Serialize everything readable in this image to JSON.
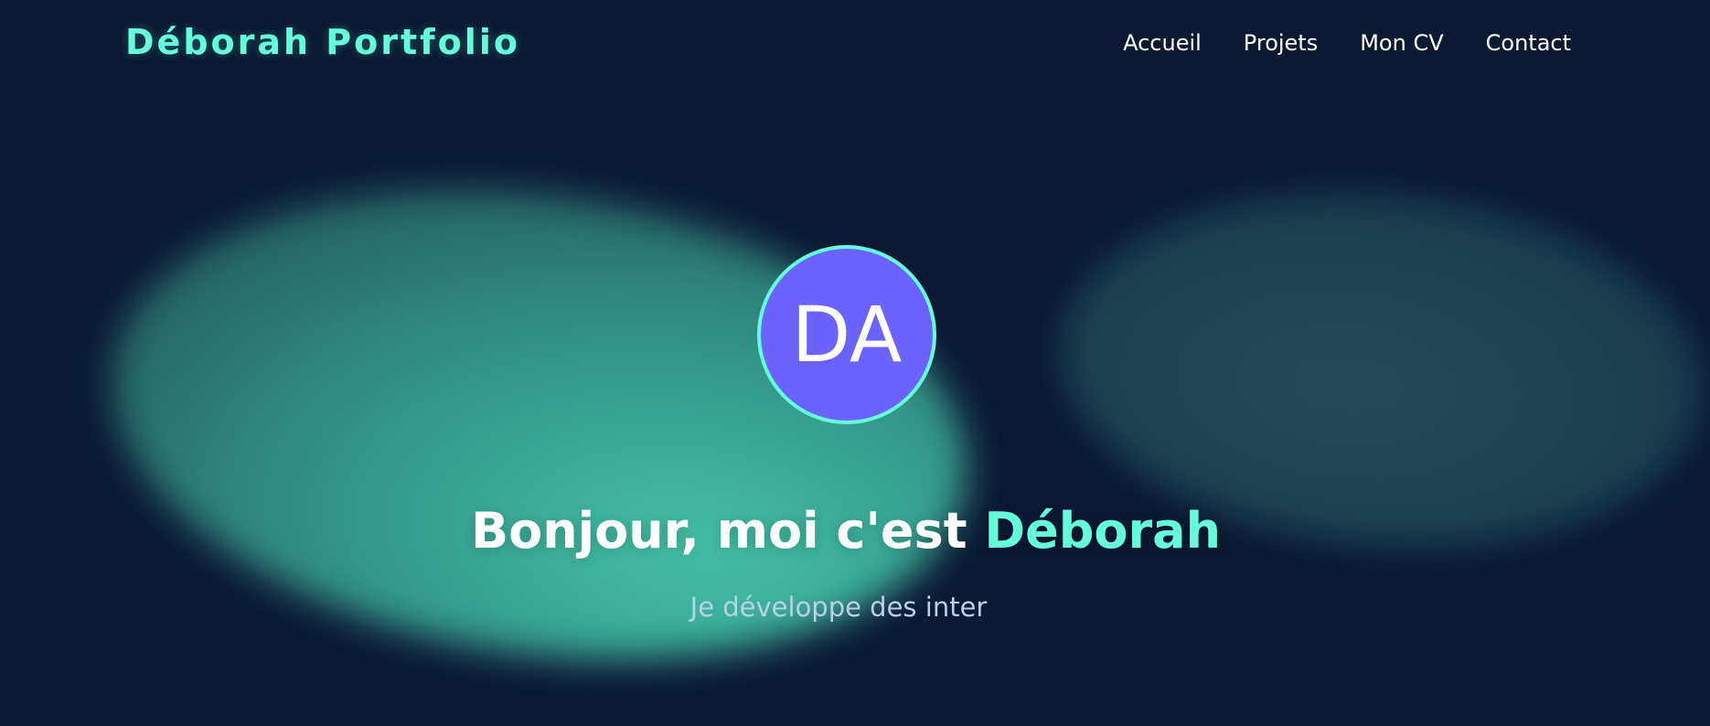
{
  "brand": {
    "name": "Déborah Portfolio"
  },
  "nav": {
    "items": [
      {
        "label": "Accueil"
      },
      {
        "label": "Projets"
      },
      {
        "label": "Mon CV"
      },
      {
        "label": "Contact"
      }
    ]
  },
  "hero": {
    "avatar_initials": "DA",
    "title_prefix": "Bonjour, moi c'est ",
    "title_name": "Déborah",
    "subtitle": "Je développe des inter"
  },
  "colors": {
    "background": "#0b1932",
    "accent": "#64ffda",
    "avatar": "#6c63ff",
    "text": "#ffffff",
    "subtitle": "#b9d0e6"
  }
}
